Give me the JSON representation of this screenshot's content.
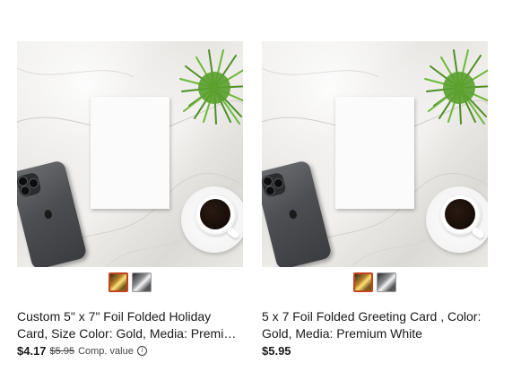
{
  "products": [
    {
      "title": "Custom 5\" x 7\" Foil Folded Holiday Card, Size Color: Gold, Media: Premium Whit...",
      "price": "$4.17",
      "original_price": "$5.95",
      "comp_label": "Comp. value",
      "info_icon": "ⓘ",
      "swatches": [
        {
          "name": "gold",
          "selected": true
        },
        {
          "name": "silver",
          "selected": false
        }
      ]
    },
    {
      "title": "5 x 7 Foil Folded Greeting Card , Color: Gold, Media: Premium White",
      "price": "$5.95",
      "swatches": [
        {
          "name": "gold",
          "selected": true
        },
        {
          "name": "silver",
          "selected": false
        }
      ]
    }
  ],
  "colors": {
    "selected_swatch_border": "#c5431c",
    "text": "#1a1a1a"
  },
  "icons": [
    "info-icon"
  ]
}
